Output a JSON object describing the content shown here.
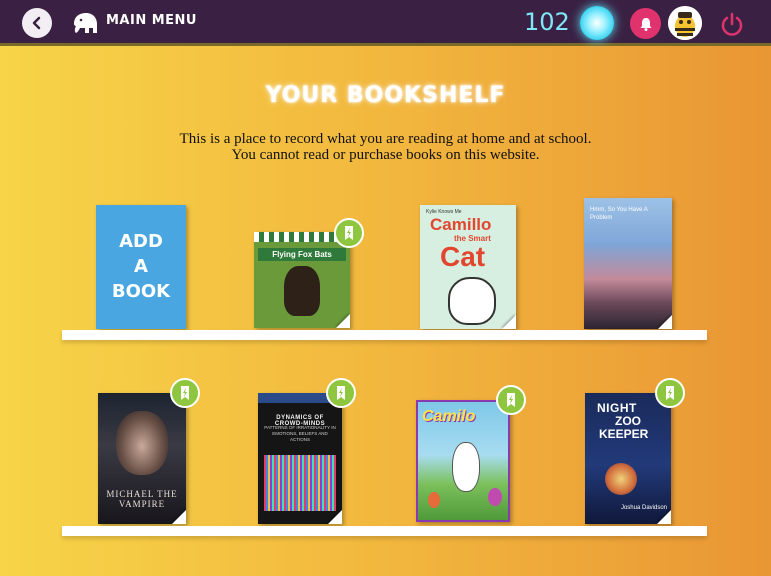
{
  "header": {
    "menu_label": "MAIN MENU",
    "points": "102"
  },
  "page": {
    "title": "YOUR BOOKSHELF",
    "intro_line1": "This is a place to record what you are reading at home and at school.",
    "intro_line2": "You cannot read or purchase books on this website."
  },
  "shelf_top": {
    "add_book": {
      "line1": "ADD",
      "line2": "A",
      "line3": "BOOK"
    },
    "books": [
      {
        "title": "Flying Fox Bats"
      },
      {
        "series": "Kylie Knows Me",
        "title_word1": "Camillo",
        "title_word2": "the Smart",
        "title_word3": "Cat"
      },
      {
        "title": "Hmm, So You Have A Problem"
      }
    ]
  },
  "shelf_bottom": {
    "books": [
      {
        "title": "Michael the Vampire"
      },
      {
        "title": "Dynamics of Crowd-Minds",
        "subtitle": "Patterns of Irrationality in Emotions, Beliefs and Actions"
      },
      {
        "title": "Camilo"
      },
      {
        "title_word1": "NIGHT",
        "title_word2": "ZOO",
        "title_word3": "KEEPER",
        "author": "Joshua Davidson"
      }
    ]
  },
  "colors": {
    "topbar": "#3a2143",
    "add_book_blue": "#4aa6e0",
    "badge_green": "#8ec63f",
    "points_cyan": "#7fe6f7",
    "bell_pink": "#e0336d"
  }
}
